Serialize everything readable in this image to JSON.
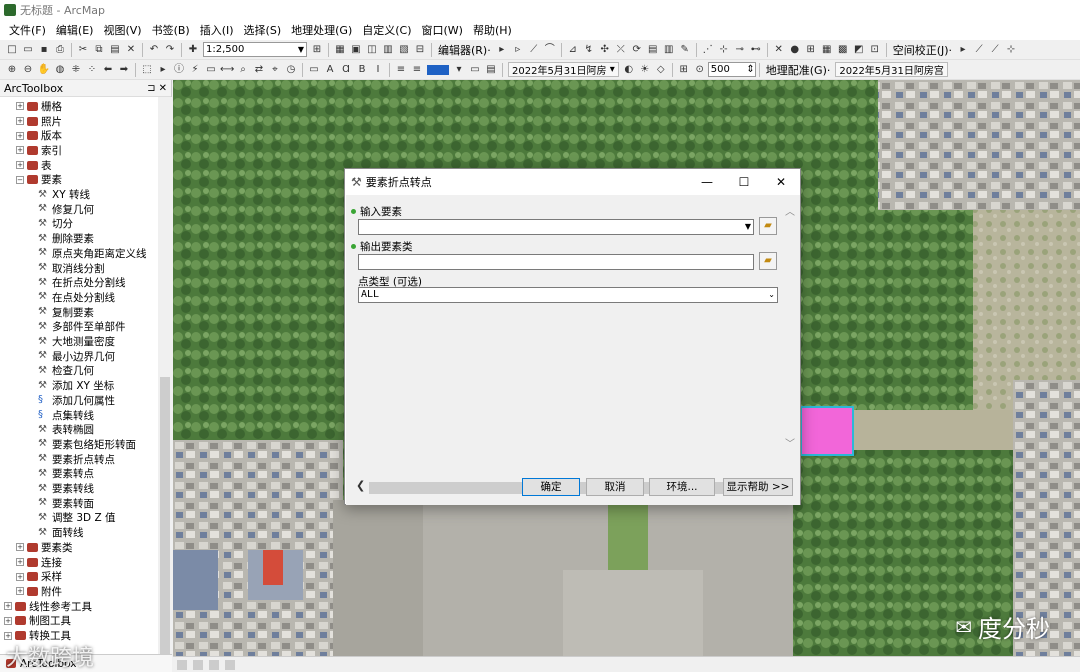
{
  "window": {
    "title": "无标题 - ArcMap"
  },
  "menubar": [
    "文件(F)",
    "编辑(E)",
    "视图(V)",
    "书签(B)",
    "插入(I)",
    "选择(S)",
    "地理处理(G)",
    "自定义(C)",
    "窗口(W)",
    "帮助(H)"
  ],
  "toolbar1": {
    "scale": "1:2,500",
    "editor_label": "编辑器(R)·",
    "spatial_adjust_label": "空间校正(J)·"
  },
  "toolbar2": {
    "date_layer": "2022年5月31日阿房",
    "zoom_value": "500",
    "georef_label": "地理配准(G)·",
    "georef_layer": "2022年5月31日阿房宫"
  },
  "toolbox": {
    "title": "ArcToolbox",
    "items": [
      {
        "label": "栅格",
        "type": "toolbox",
        "level": 1,
        "expander": "+"
      },
      {
        "label": "照片",
        "type": "toolbox",
        "level": 1,
        "expander": "+"
      },
      {
        "label": "版本",
        "type": "toolbox",
        "level": 1,
        "expander": "+"
      },
      {
        "label": "索引",
        "type": "toolbox",
        "level": 1,
        "expander": "+"
      },
      {
        "label": "表",
        "type": "toolbox",
        "level": 1,
        "expander": "+"
      },
      {
        "label": "要素",
        "type": "toolbox",
        "level": 1,
        "expander": "−"
      },
      {
        "label": "XY 转线",
        "type": "tool",
        "level": 2
      },
      {
        "label": "修复几何",
        "type": "tool",
        "level": 2
      },
      {
        "label": "切分",
        "type": "tool",
        "level": 2
      },
      {
        "label": "删除要素",
        "type": "tool",
        "level": 2
      },
      {
        "label": "原点夹角距离定义线",
        "type": "tool",
        "level": 2
      },
      {
        "label": "取消线分割",
        "type": "tool",
        "level": 2
      },
      {
        "label": "在折点处分割线",
        "type": "tool",
        "level": 2
      },
      {
        "label": "在点处分割线",
        "type": "tool",
        "level": 2
      },
      {
        "label": "复制要素",
        "type": "tool",
        "level": 2
      },
      {
        "label": "多部件至单部件",
        "type": "tool",
        "level": 2
      },
      {
        "label": "大地测量密度",
        "type": "tool",
        "level": 2
      },
      {
        "label": "最小边界几何",
        "type": "tool",
        "level": 2
      },
      {
        "label": "检查几何",
        "type": "tool",
        "level": 2
      },
      {
        "label": "添加 XY 坐标",
        "type": "tool",
        "level": 2
      },
      {
        "label": "添加几何属性",
        "type": "script",
        "level": 2
      },
      {
        "label": "点集转线",
        "type": "script",
        "level": 2
      },
      {
        "label": "表转椭圆",
        "type": "tool",
        "level": 2
      },
      {
        "label": "要素包络矩形转面",
        "type": "tool",
        "level": 2
      },
      {
        "label": "要素折点转点",
        "type": "tool",
        "level": 2
      },
      {
        "label": "要素转点",
        "type": "tool",
        "level": 2
      },
      {
        "label": "要素转线",
        "type": "tool",
        "level": 2
      },
      {
        "label": "要素转面",
        "type": "tool",
        "level": 2
      },
      {
        "label": "调整 3D Z 值",
        "type": "tool",
        "level": 2
      },
      {
        "label": "面转线",
        "type": "tool",
        "level": 2
      },
      {
        "label": "要素类",
        "type": "toolbox",
        "level": 1,
        "expander": "+"
      },
      {
        "label": "连接",
        "type": "toolbox",
        "level": 1,
        "expander": "+"
      },
      {
        "label": "采样",
        "type": "toolbox",
        "level": 1,
        "expander": "+"
      },
      {
        "label": "附件",
        "type": "toolbox",
        "level": 1,
        "expander": "+"
      },
      {
        "label": "线性参考工具",
        "type": "toolbox",
        "level": 0,
        "expander": "+"
      },
      {
        "label": "制图工具",
        "type": "toolbox",
        "level": 0,
        "expander": "+"
      },
      {
        "label": "转换工具",
        "type": "toolbox",
        "level": 0,
        "expander": "+"
      }
    ],
    "tab_label": "ArcToolbox"
  },
  "dialog": {
    "title": "要素折点转点",
    "input_label": "输入要素",
    "input_value": "",
    "output_label": "输出要素类",
    "output_value": "",
    "point_type_label": "点类型 (可选)",
    "point_type_value": "ALL",
    "buttons": {
      "ok": "确定",
      "cancel": "取消",
      "env": "环境...",
      "help": "显示帮助 >>"
    }
  },
  "watermark": {
    "left": "大数跨境",
    "right": "度分秒"
  },
  "colors": {
    "highlight_polygon": "#f266d9",
    "highlight_border": "#2bb8d6"
  }
}
